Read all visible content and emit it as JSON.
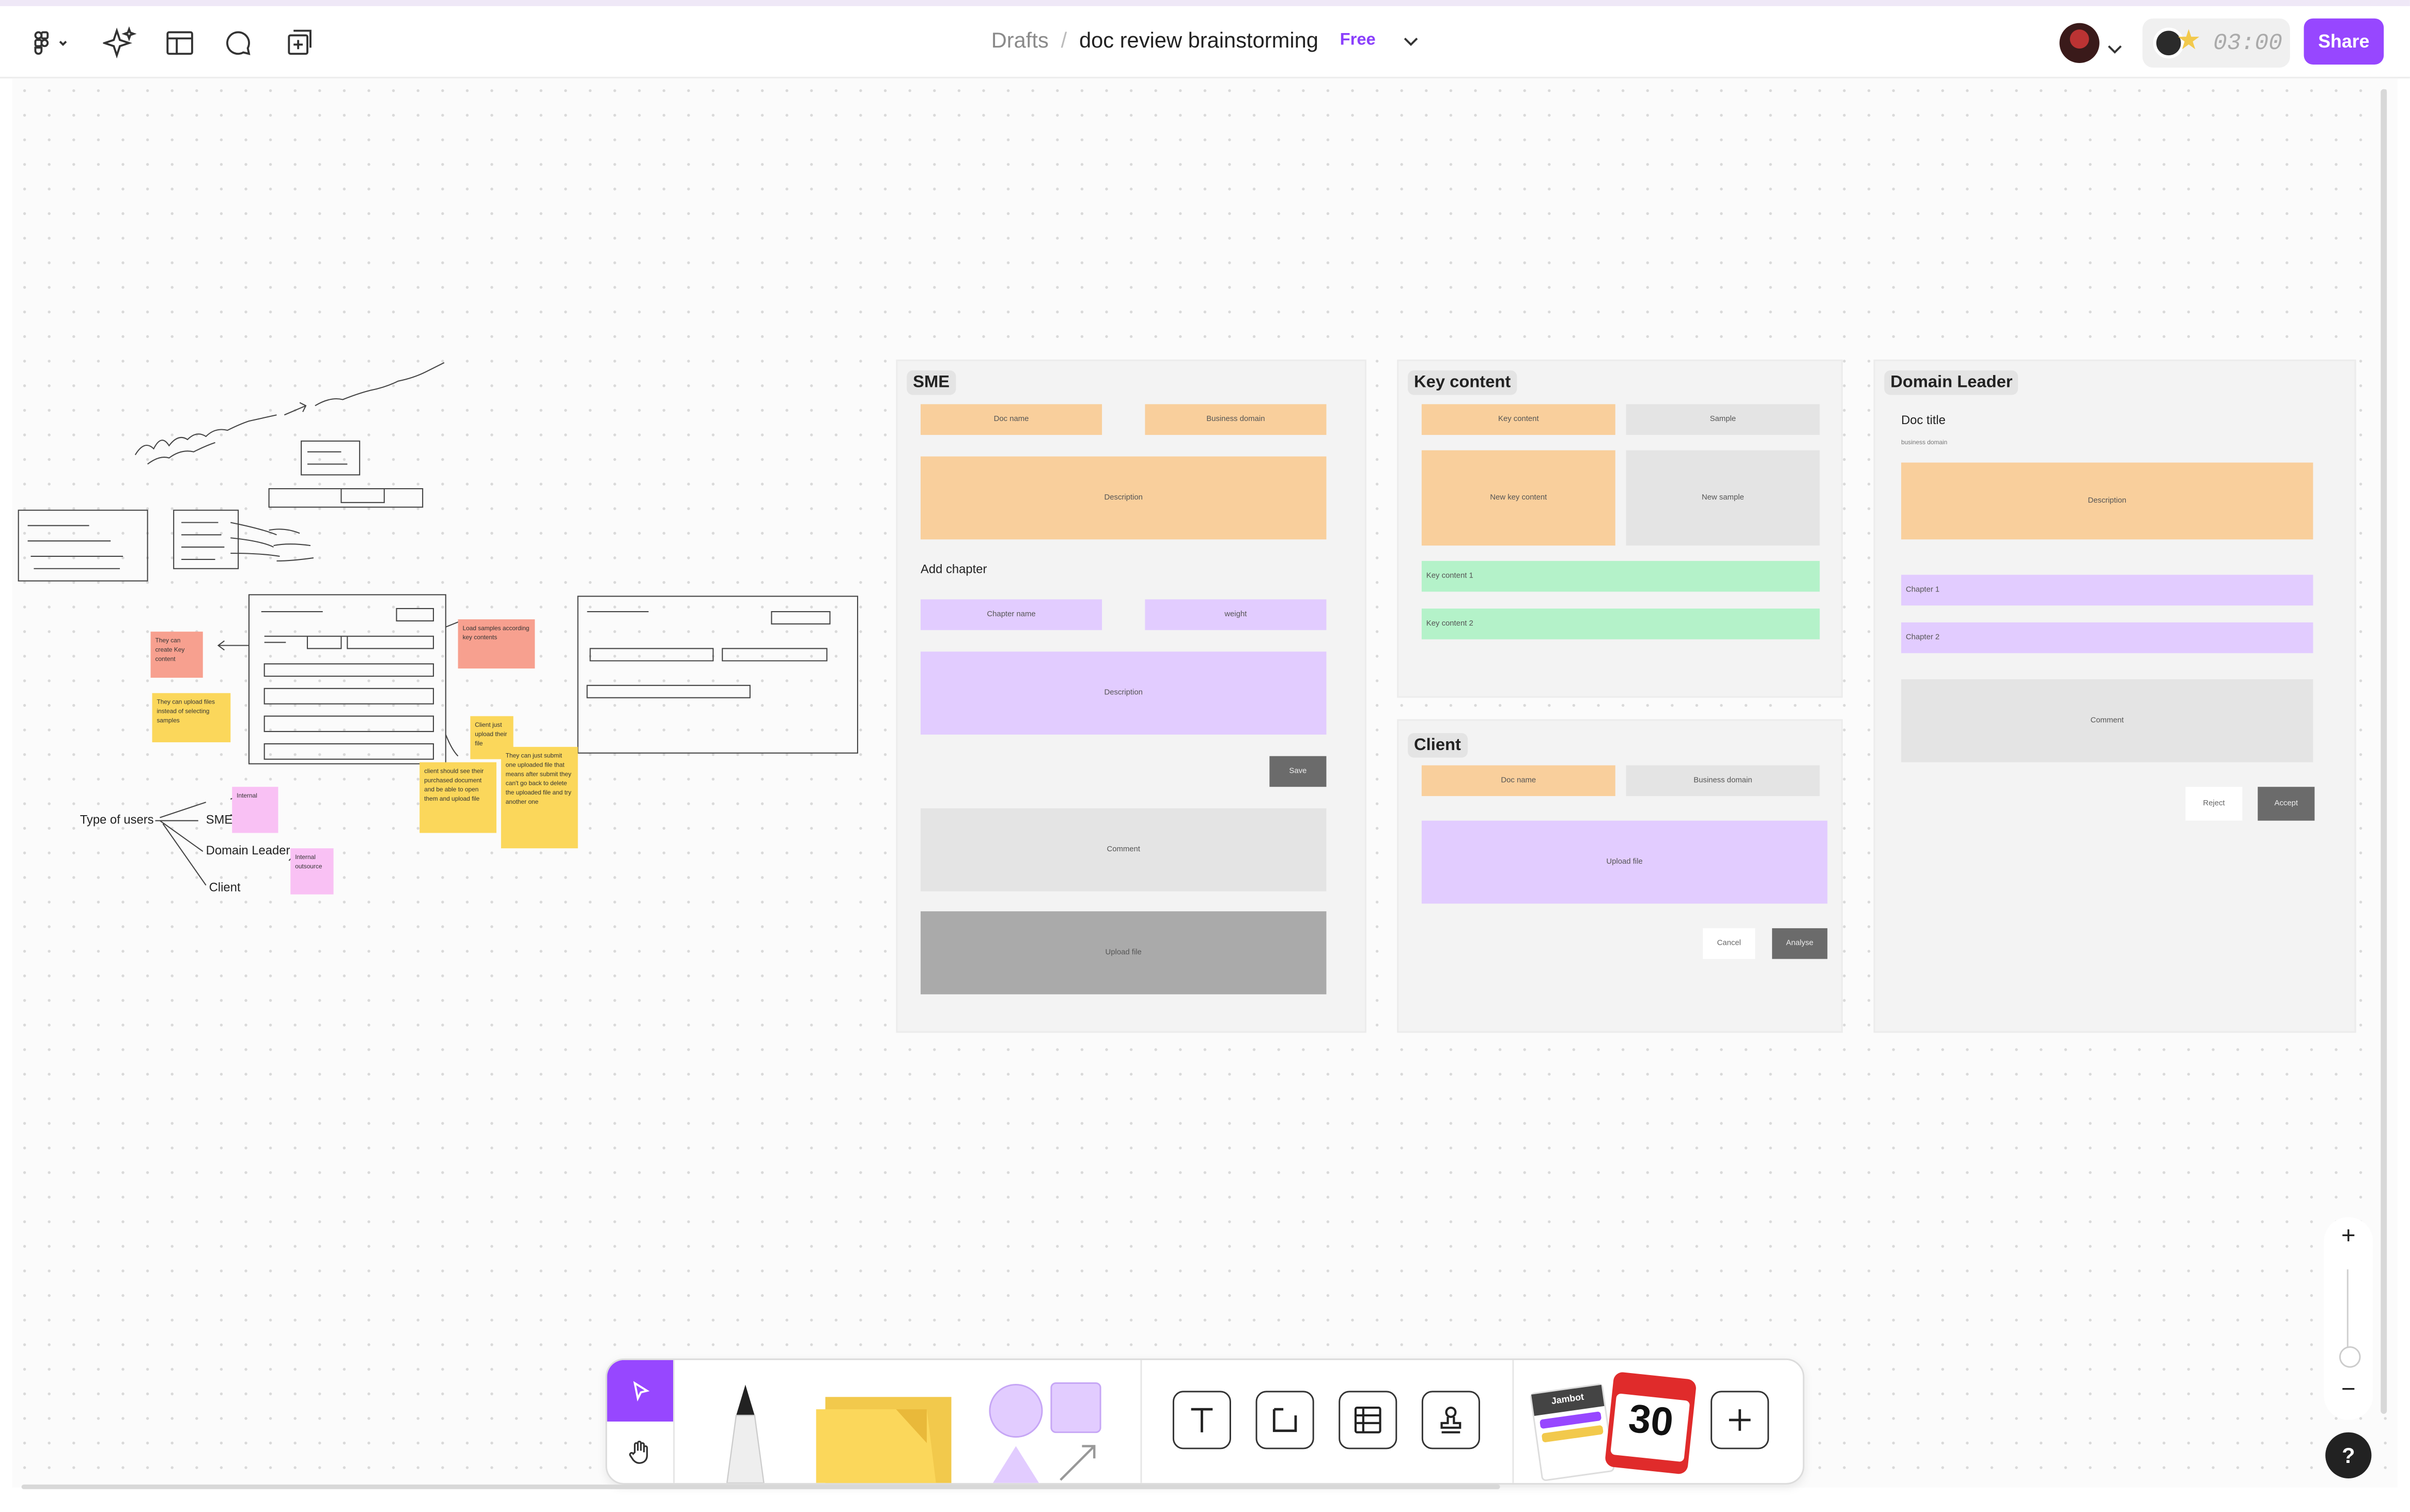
{
  "header": {
    "breadcrumb_drafts": "Drafts",
    "breadcrumb_sep": "/",
    "file_name": "doc review brainstorming",
    "plan_badge": "Free",
    "timer": "03:00",
    "share_label": "Share",
    "accent_color": "#9747ff"
  },
  "sketch": {
    "type_of_users": "Type of users",
    "sme": "SME",
    "domain_leader": "Domain Leader",
    "client": "Client",
    "sticky_internal": "Internal",
    "sticky_internal_outsource": "Internal outsource",
    "sticky_create_key": "They can create Key content",
    "sticky_upload_files": "They can upload files instead of selecting samples",
    "sticky_load_samples": "Load samples according key contents",
    "sticky_client_just": "Client just upload their file",
    "sticky_client_should": "client should see their purchased document and be able to open them and upload file",
    "sticky_they_can_just": "They can just submit one uploaded file that means after submit they can't go back to delete the uploaded file and try another one"
  },
  "sme": {
    "title": "SME",
    "doc_name": "Doc name",
    "business_domain": "Business domain",
    "description": "Description",
    "add_chapter": "Add chapter",
    "chapter_name": "Chapter name",
    "weight": "weight",
    "chapter_description": "Description",
    "save": "Save",
    "comment": "Comment",
    "upload_file": "Upload file"
  },
  "key_content": {
    "title": "Key content",
    "key_content": "Key content",
    "sample": "Sample",
    "new_key_content": "New key content",
    "new_sample": "New sample",
    "item1": "Key content 1",
    "item2": "Key content 2"
  },
  "client": {
    "title": "Client",
    "doc_name": "Doc name",
    "business_domain": "Business domain",
    "upload_file": "Upload file",
    "cancel": "Cancel",
    "analyse": "Analyse"
  },
  "domain_leader": {
    "title": "Domain Leader",
    "doc_title": "Doc title",
    "business_domain": "business domain",
    "description": "Description",
    "chapter1": "Chapter 1",
    "chapter2": "Chapter 2",
    "comment": "Comment",
    "reject": "Reject",
    "accept": "Accept"
  },
  "toolbar": {
    "badge_number": "30",
    "badge_label": "Jambot"
  },
  "zoom": {
    "plus": "+",
    "minus": "−"
  },
  "help_label": "?"
}
